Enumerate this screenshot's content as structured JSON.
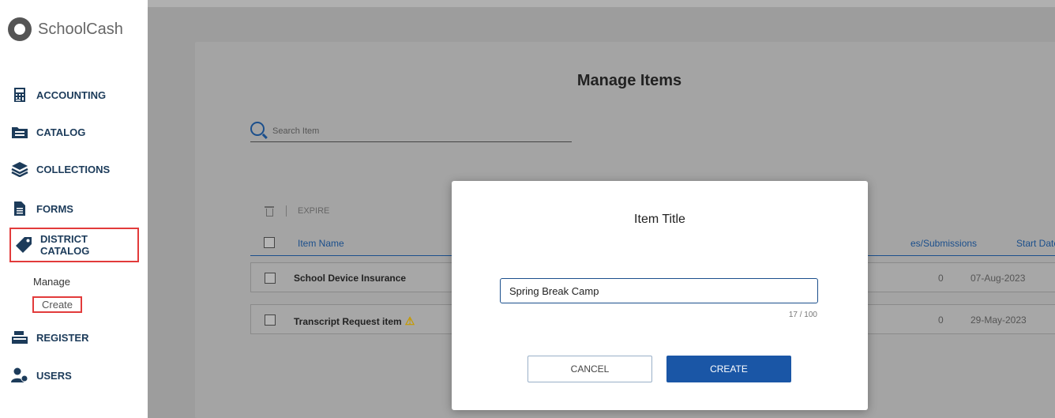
{
  "app": {
    "name": "SchoolCash"
  },
  "sidebar": {
    "items": [
      {
        "label": "ACCOUNTING",
        "icon": "calculator-icon"
      },
      {
        "label": "CATALOG",
        "icon": "folder-icon"
      },
      {
        "label": "COLLECTIONS",
        "icon": "layers-icon"
      },
      {
        "label": "FORMS",
        "icon": "document-icon"
      },
      {
        "label": "DISTRICT CATALOG",
        "icon": "tag-icon"
      },
      {
        "label": "REGISTER",
        "icon": "cash-register-icon"
      },
      {
        "label": "USERS",
        "icon": "users-icon"
      }
    ],
    "submenu": {
      "manage": "Manage",
      "create": "Create"
    }
  },
  "main": {
    "title": "Manage Items",
    "search": {
      "placeholder": "Search Item"
    },
    "toolbar": {
      "expire": "EXPIRE"
    },
    "table": {
      "columns": [
        "Item Name",
        "es/Submissions",
        "Start Date ↓"
      ],
      "rows": [
        {
          "name": "School Device Insurance",
          "submissions": "0",
          "start_date": "07-Aug-2023",
          "warning": false
        },
        {
          "name": "Transcript Request item",
          "submissions": "0",
          "start_date": "29-May-2023",
          "warning": true
        }
      ]
    }
  },
  "modal": {
    "title": "Item Title",
    "input_value": "Spring Break Camp",
    "counter": "17 / 100",
    "cancel_label": "CANCEL",
    "create_label": "CREATE"
  },
  "colors": {
    "primary": "#1a56a6",
    "highlight": "#e23b3b",
    "nav_text": "#1c3b5a",
    "overlay": "#9d9d9d"
  }
}
